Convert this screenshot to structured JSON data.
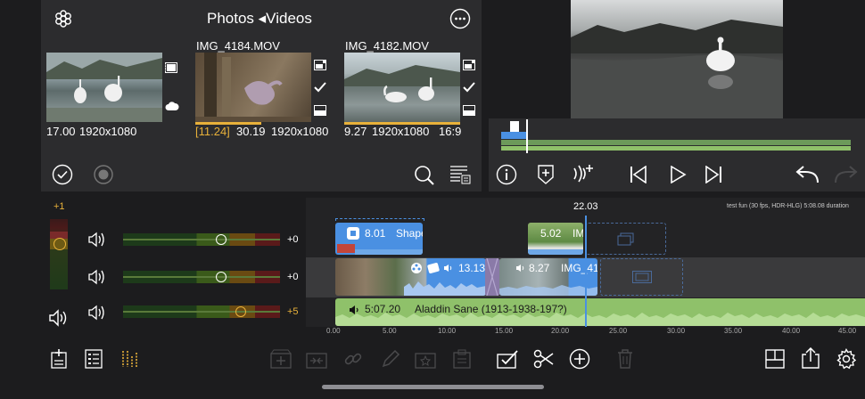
{
  "browser": {
    "title": "Photos ◂Videos",
    "items": [
      {
        "name": "",
        "duration": "17.00",
        "resolution": "1920x1080",
        "extra": "",
        "inpoint": ""
      },
      {
        "name": "IMG_4184.MOV",
        "duration": "30.19",
        "resolution": "1920x1080",
        "extra": "",
        "inpoint": "[11.24]"
      },
      {
        "name": "IMG_4182.MOV",
        "duration": "9.27",
        "resolution": "1920x1080",
        "extra": "16:9",
        "inpoint": ""
      }
    ]
  },
  "timeline": {
    "playhead_time": "22.03",
    "project_info": "test fun (30 fps, HDR-HLG)  5:08.08 duration",
    "clips": {
      "title_clip": {
        "duration": "8.01",
        "name": "Shape"
      },
      "upper_clip": {
        "duration": "5.02",
        "name": "IM"
      },
      "main_clip_a": {
        "duration": "13.13"
      },
      "main_clip_b": {
        "duration": "8.27",
        "name": "IMG_41"
      },
      "audio_clip": {
        "duration": "5:07.20",
        "name": "Aladdin Sane (1913-1938-197?)"
      }
    },
    "ruler_ticks": [
      "0.00",
      "5.00",
      "10.00",
      "15.00",
      "20.00",
      "25.00",
      "30.00",
      "35.00",
      "40.00",
      "45.00"
    ]
  },
  "mixer": {
    "meter_label": "+1",
    "tracks": [
      {
        "level": "+0",
        "level_fraction": 0.55
      },
      {
        "level": "+0",
        "level_fraction": 0.55
      },
      {
        "level": "+5",
        "level_fraction": 0.68
      }
    ]
  },
  "colors": {
    "accent_blue": "#4a90e2",
    "audio_green": "#8fc16a",
    "inpoint_yellow": "#e8b13a"
  }
}
